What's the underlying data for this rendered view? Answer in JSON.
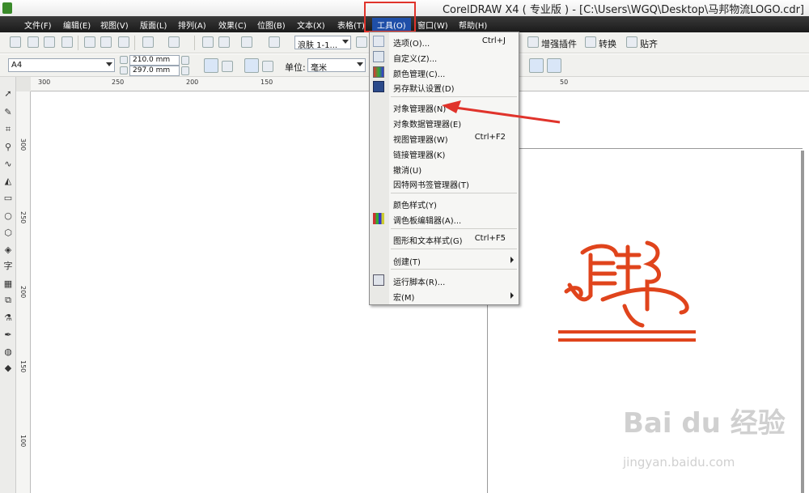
{
  "window": {
    "title": "CorelDRAW X4 ( 专业版 ) - [C:\\Users\\WGQ\\Desktop\\马邦物流LOGO.cdr]"
  },
  "menubar": {
    "items": [
      "文件(F)",
      "编辑(E)",
      "视图(V)",
      "版面(L)",
      "排列(A)",
      "效果(C)",
      "位图(B)",
      "文本(X)",
      "表格(T)",
      "工具(O)",
      "窗口(W)",
      "帮助(H)"
    ],
    "active": "工具(O)"
  },
  "toolbar": {
    "zoom_combo": "浪肤  1-1...",
    "buttons": [
      "增强插件",
      "转换",
      "贴齐"
    ]
  },
  "property_bar": {
    "page_size": "A4",
    "width": "210.0 mm",
    "height": "297.0 mm",
    "unit_label": "单位:",
    "unit_value": "毫米"
  },
  "ruler": {
    "h_ticks": [
      "300",
      "250",
      "200",
      "150",
      "50"
    ],
    "v_ticks": [
      "300",
      "250",
      "200",
      "150",
      "100"
    ]
  },
  "tools_menu": {
    "items": [
      {
        "label": "选项(O)...",
        "shortcut": "Ctrl+J",
        "icon": "options-icon"
      },
      {
        "label": "自定义(Z)...",
        "shortcut": "",
        "icon": "customize-icon"
      },
      {
        "label": "颜色管理(C)...",
        "shortcut": "",
        "icon": "color-management-icon"
      },
      {
        "label": "另存默认设置(D)",
        "shortcut": "",
        "icon": "save-defaults-icon"
      },
      {
        "label": "对象管理器(N)",
        "shortcut": "",
        "icon": ""
      },
      {
        "label": "对象数据管理器(E)",
        "shortcut": "",
        "icon": ""
      },
      {
        "label": "视图管理器(W)",
        "shortcut": "Ctrl+F2",
        "icon": ""
      },
      {
        "label": "链接管理器(K)",
        "shortcut": "",
        "icon": ""
      },
      {
        "label": "撤消(U)",
        "shortcut": "",
        "icon": ""
      },
      {
        "label": "因特网书签管理器(T)",
        "shortcut": "",
        "icon": ""
      },
      {
        "label": "颜色样式(Y)",
        "shortcut": "",
        "icon": ""
      },
      {
        "label": "调色板编辑器(A)...",
        "shortcut": "",
        "icon": "palette-editor-icon"
      },
      {
        "label": "图形和文本样式(G)",
        "shortcut": "Ctrl+F5",
        "icon": ""
      },
      {
        "label": "创建(T)",
        "shortcut": "",
        "icon": "",
        "submenu": true
      },
      {
        "label": "运行脚本(R)...",
        "shortcut": "",
        "icon": "run-script-icon"
      },
      {
        "label": "宏(M)",
        "shortcut": "",
        "icon": "",
        "submenu": true
      }
    ]
  },
  "colors": {
    "accent": "#1f4fa8",
    "annotation": "#e0332b",
    "logo": "#e0441c"
  },
  "watermark": {
    "brand": "Bai du 经验",
    "url": "jingyan.baidu.com"
  }
}
